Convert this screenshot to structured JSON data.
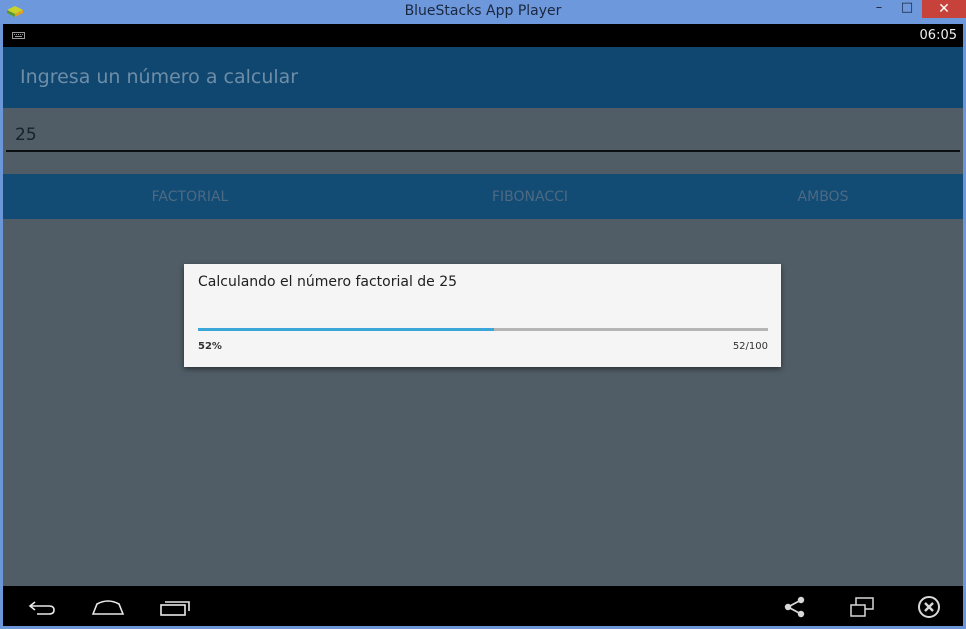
{
  "window": {
    "title": "BlueStacks App Player",
    "minimize_glyph": "–",
    "maximize_glyph": "□",
    "close_glyph": "✕",
    "close_color": "#c7423a"
  },
  "statusbar": {
    "time": "06:05"
  },
  "actionbar": {
    "title": "Ingresa un número a calcular",
    "color": "#104771"
  },
  "input": {
    "value": "25"
  },
  "buttons": {
    "factorial": "FACTORIAL",
    "fibonacci": "FIBONACCI",
    "ambos": "AMBOS"
  },
  "dialog": {
    "message": "Calculando el número factorial de 25",
    "progress_fraction": 0.52,
    "percent_label": "52%",
    "count_label": "52/100",
    "accent": "#3aa7d8"
  },
  "navbar": {
    "icons": [
      "back-icon",
      "home-icon",
      "recent-apps-icon",
      "share-icon",
      "rotate-screen-icon",
      "close-app-icon"
    ]
  }
}
